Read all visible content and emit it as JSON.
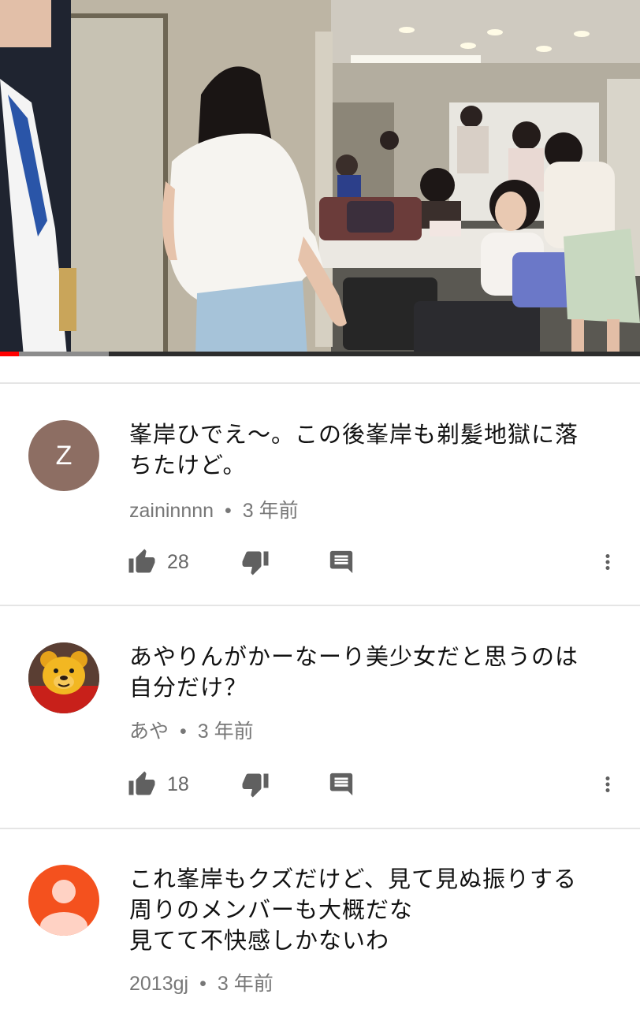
{
  "video": {
    "progress_played": 0.03,
    "progress_buffered": 0.17
  },
  "comments": [
    {
      "avatar_type": "letter",
      "avatar_letter": "Z",
      "avatar_color": "#8d6e63",
      "text": "峯岸ひでえ〜。この後峯岸も剃髪地獄に落\nちたけど。",
      "author": "zaininnnn",
      "separator": "•",
      "time": "3 年前",
      "likes": "28"
    },
    {
      "avatar_type": "image",
      "avatar_icon": "winnie-the-pooh-avatar",
      "text": "あやりんがかーなーり美少女だと思うのは\n自分だけ？",
      "author": "あや",
      "separator": "•",
      "time": "3 年前",
      "likes": "18"
    },
    {
      "avatar_type": "default",
      "avatar_color": "#f4511e",
      "text": "これ峯岸もクズだけど、見て見ぬ振りする\n周りのメンバーも大概だな\n見てて不快感しかないわ",
      "author": "2013gj",
      "separator": "•",
      "time": "3 年前"
    }
  ],
  "icons": {
    "like": "thumb-up-icon",
    "dislike": "thumb-down-icon",
    "reply": "reply-icon",
    "more": "more-vert-icon"
  }
}
